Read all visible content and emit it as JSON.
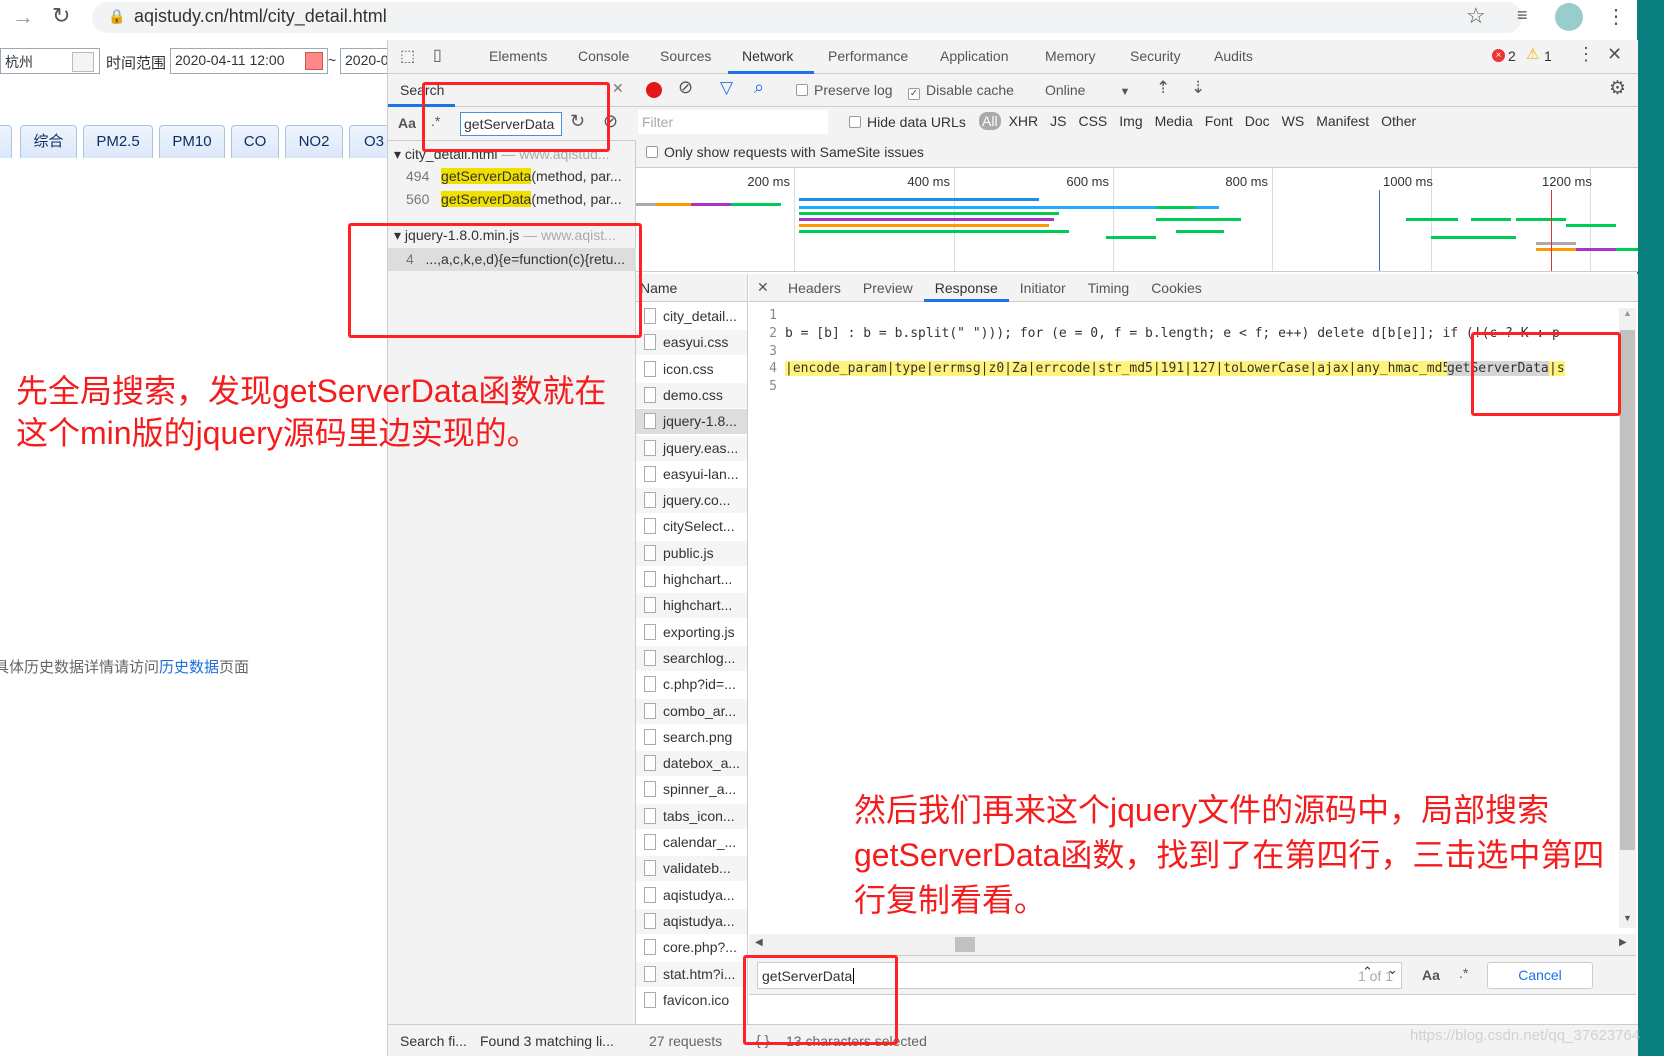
{
  "browser": {
    "url": "aqistudy.cn/html/city_detail.html"
  },
  "page": {
    "city": "杭州",
    "time_range_label": "时间范围",
    "start": "2020-04-11 12:00",
    "end": "2020-0",
    "tabs": [
      "综合",
      "PM2.5",
      "PM10",
      "CO",
      "NO2",
      "O3"
    ],
    "history_text": "具体历史数据详情请访问",
    "history_link": "历史数据",
    "history_suffix": "页面"
  },
  "devtools": {
    "tabs": [
      "Elements",
      "Console",
      "Sources",
      "Network",
      "Performance",
      "Application",
      "Memory",
      "Security",
      "Audits"
    ],
    "active_tab": "Network",
    "errors": "2",
    "warnings": "1",
    "search": {
      "title": "Search",
      "case_label": "Aa",
      "regex_label": ".*",
      "query": "getServerData",
      "groups": [
        {
          "file": "city_detail.html",
          "origin": "— www.aqistud...",
          "results": [
            {
              "line": "494",
              "match": "getServerData",
              "rest": "(method, par..."
            },
            {
              "line": "560",
              "match": "getServerData",
              "rest": "(method, par..."
            }
          ]
        },
        {
          "file": "jquery-1.8.0.min.js",
          "origin": "— www.aqist...",
          "results": [
            {
              "line": "4",
              "match": "",
              "rest": "...,a,c,k,e,d){e=function(c){retu..."
            }
          ]
        }
      ],
      "status_left": "Search fi...",
      "status_right": "Found 3 matching li..."
    },
    "network": {
      "preserve_log": "Preserve log",
      "disable_cache": "Disable cache",
      "throttle": "Online",
      "filter_placeholder": "Filter",
      "hide_data_urls": "Hide data URLs",
      "types": [
        "All",
        "XHR",
        "JS",
        "CSS",
        "Img",
        "Media",
        "Font",
        "Doc",
        "WS",
        "Manifest",
        "Other"
      ],
      "samesite": "Only show requests with SameSite issues",
      "ticks": [
        "200 ms",
        "400 ms",
        "600 ms",
        "800 ms",
        "1000 ms",
        "1200 ms"
      ],
      "name_header": "Name",
      "files": [
        "city_detail...",
        "easyui.css",
        "icon.css",
        "demo.css",
        "jquery-1.8...",
        "jquery.eas...",
        "easyui-lan...",
        "jquery.co...",
        "citySelect...",
        "public.js",
        "highchart...",
        "highchart...",
        "exporting.js",
        "searchlog...",
        "c.php?id=...",
        "combo_ar...",
        "search.png",
        "datebox_a...",
        "spinner_a...",
        "tabs_icon...",
        "calendar_...",
        "validateb...",
        "aqistudya...",
        "aqistudya...",
        "core.php?...",
        "stat.htm?i...",
        "favicon.ico"
      ],
      "requests": "27 requests",
      "detail_tabs": [
        "Headers",
        "Preview",
        "Response",
        "Initiator",
        "Timing",
        "Cookies"
      ],
      "active_detail": "Response",
      "code_lines": [
        {
          "n": "1",
          "text": ""
        },
        {
          "n": "2",
          "text": "b = [b] : b = b.split(\" \"))); for (e = 0, f = b.length; e < f; e++) delete d[b[e]]; if (!(c ? K : p"
        },
        {
          "n": "3",
          "text": ""
        },
        {
          "n": "4",
          "text": "|encode_param|type|errmsg|z0|Za|errcode|str_md5|191|127|toLowerCase|ajax|any_hmac_md5|",
          "match": "getServerData",
          "after": "|s"
        },
        {
          "n": "5",
          "text": ""
        }
      ],
      "find_query": "getServerData",
      "find_count": "1 of 1",
      "find_case": "Aa",
      "find_regex": ".*",
      "cancel": "Cancel",
      "selection_status": "13 characters selected",
      "pretty_print": "{ }"
    }
  },
  "annotations": {
    "note1": [
      "先全局搜索，发现getServerData函数就在",
      "这个min版的jquery源码里边实现的。"
    ],
    "note2": [
      "然后我们再来这个jquery文件的源码中，局部搜索",
      "getServerData函数，找到了在第四行，三击选中第四",
      "行复制看看。"
    ]
  },
  "watermark": "https://blog.csdn.net/qq_37623764",
  "colors": {
    "annotation": "#f41c1c",
    "highlight": "#f0e000",
    "accent": "#1a73e8",
    "teal": "#0a7f7f"
  }
}
